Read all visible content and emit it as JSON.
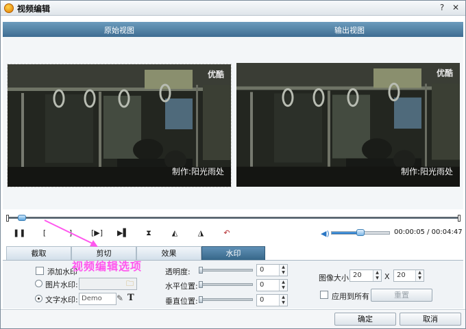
{
  "window": {
    "title": "视频编辑"
  },
  "preview": {
    "original_label": "原始视图",
    "output_label": "输出视图",
    "logo_text": "优酷",
    "watermark_text": "制作:阳光雨处"
  },
  "timeline": {
    "position": 0.02
  },
  "player": {
    "volume": 0.45,
    "time_readout": "00:00:05 / 00:04:47"
  },
  "tabs": [
    {
      "label": "截取",
      "active": false
    },
    {
      "label": "剪切",
      "active": false
    },
    {
      "label": "效果",
      "active": false
    },
    {
      "label": "水印",
      "active": true
    }
  ],
  "watermark": {
    "add_label": "添加水印",
    "image_label": "图片水印:",
    "text_label": "文字水印:",
    "text_value": "Demo",
    "transparency_label": "透明度:",
    "transparency_value": "0",
    "horizontal_label": "水平位置:",
    "horizontal_value": "0",
    "vertical_label": "垂直位置:",
    "vertical_value": "0",
    "size_label": "图像大小:",
    "width_value": "20",
    "times_sign": "X",
    "height_value": "20",
    "apply_all_label": "应用到所有",
    "reset_label": "重置"
  },
  "annotation": {
    "text": "视频编辑选项",
    "color": "#ff57ee"
  },
  "footer": {
    "ok_label": "确定",
    "cancel_label": "取消"
  },
  "colors": {
    "header": "#4a7aa0",
    "active_tab": "#376789",
    "accent": "#2a76c4"
  }
}
